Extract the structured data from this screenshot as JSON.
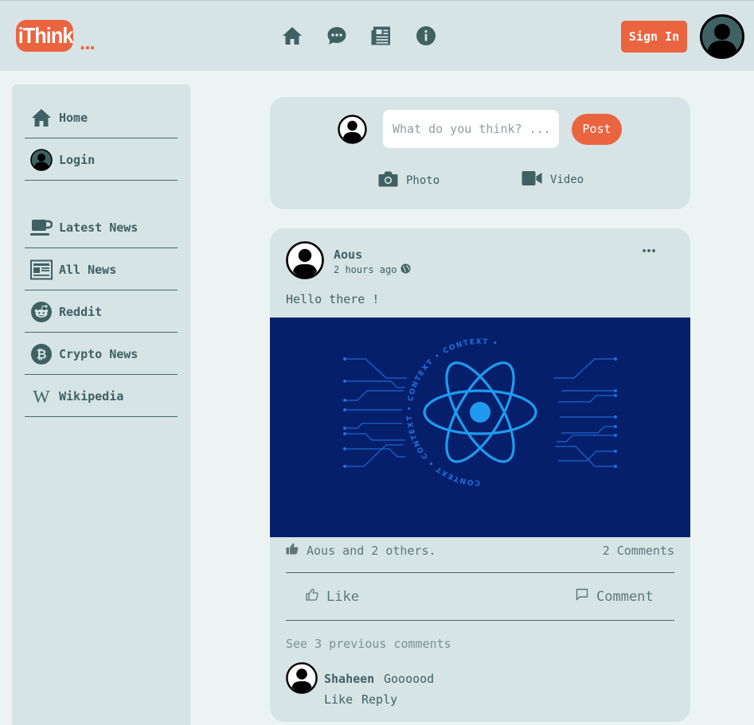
{
  "header": {
    "logo_text": "iThink",
    "logo_dots": "...",
    "nav_icons": [
      "home-icon",
      "chat-icon",
      "newspaper-icon",
      "info-icon"
    ],
    "sign_in_label": "Sign In"
  },
  "sidebar": {
    "items": [
      {
        "label": "Home",
        "icon": "home-icon"
      },
      {
        "label": "Login",
        "icon": "user-icon"
      },
      {
        "label": "Latest News",
        "icon": "coffee-cup-icon"
      },
      {
        "label": "All News",
        "icon": "newspaper-icon"
      },
      {
        "label": "Reddit",
        "icon": "reddit-icon"
      },
      {
        "label": "Crypto News",
        "icon": "bitcoin-icon"
      },
      {
        "label": "Wikipedia",
        "icon": "wikipedia-icon"
      }
    ]
  },
  "composer": {
    "placeholder": "What do you think? ...",
    "post_label": "Post",
    "photo_label": "Photo",
    "video_label": "Video"
  },
  "post": {
    "author": "Aous",
    "time": "2 hours ago",
    "text": "Hello there !",
    "image_caption_text": "CONTEXT",
    "likes_text": "Aous and 2 others.",
    "comments_count_text": "2 Comments",
    "like_label": "Like",
    "comment_label": "Comment",
    "see_previous": "See 3 previous comments",
    "comment": {
      "author": "Shaheen",
      "text": "Goooood",
      "like_label": "Like",
      "reply_label": "Reply"
    }
  },
  "colors": {
    "accent": "#eb6440",
    "panel": "#d6e4e5",
    "background": "#ecf4f3",
    "text": "#3f6163",
    "image_bg": "#061f6b",
    "react_blue": "#1e9bf0"
  }
}
